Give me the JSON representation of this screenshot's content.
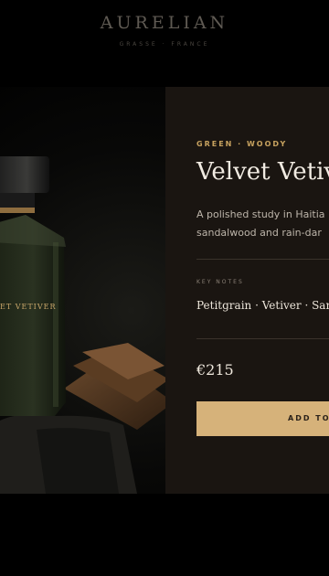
{
  "brand": {
    "name": "AURELIAN",
    "tagline": "GRASSE · FRANCE"
  },
  "hero": {
    "bottle_label": "ET VETIVER"
  },
  "product": {
    "family": "GREEN · WOODY",
    "name": "Velvet Vetiv",
    "description_line1": "A polished study in Haitia",
    "description_line2": "sandalwood and rain-dar",
    "key_notes_label": "KEY NOTES",
    "key_notes": "Petitgrain · Vetiver · Sar",
    "price": "€215",
    "cta_label": "ADD TO"
  },
  "colors": {
    "accent_gold": "#d6b27a",
    "card_bg": "#1a1511",
    "page_bg": "#000000"
  }
}
